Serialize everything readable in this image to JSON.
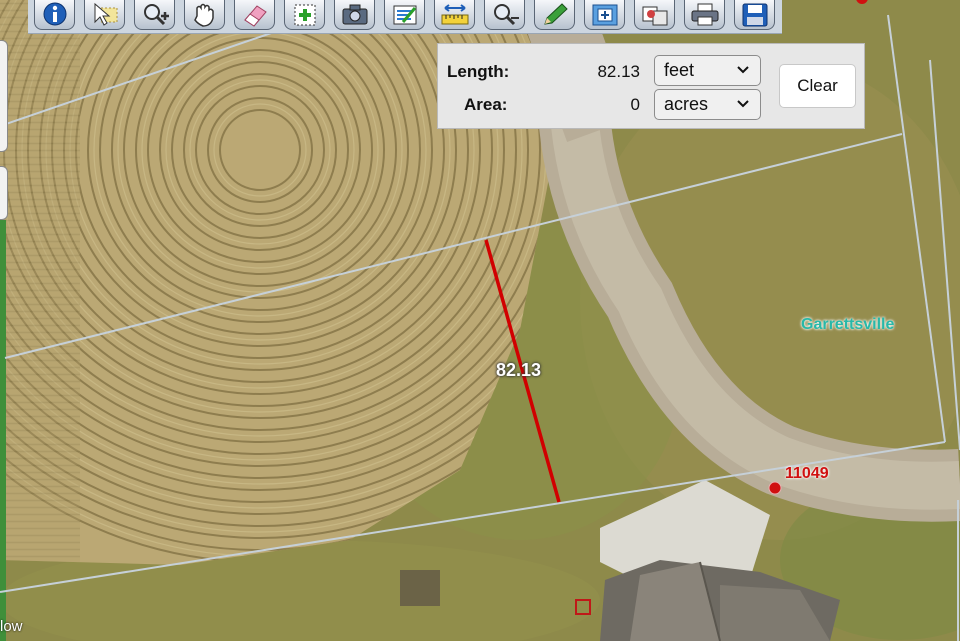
{
  "toolbar": {
    "tools": [
      {
        "name": "info-icon"
      },
      {
        "name": "select-pointer-icon"
      },
      {
        "name": "zoom-in-icon"
      },
      {
        "name": "pan-hand-icon"
      },
      {
        "name": "eraser-icon"
      },
      {
        "name": "add-selection-icon"
      },
      {
        "name": "camera-icon"
      },
      {
        "name": "layers-icon"
      },
      {
        "name": "measure-ruler-icon"
      },
      {
        "name": "zoom-out-icon"
      },
      {
        "name": "pencil-icon"
      },
      {
        "name": "select-box-icon"
      },
      {
        "name": "identify-icon"
      },
      {
        "name": "print-icon"
      },
      {
        "name": "save-icon"
      }
    ]
  },
  "measure": {
    "length_label": "Length:",
    "length_value": "82.13",
    "length_unit": "feet",
    "area_label": "Area:",
    "area_value": "0",
    "area_unit": "acres",
    "clear_label": "Clear"
  },
  "map": {
    "measure_line_label": "82.13",
    "place_label": "Garrettsville",
    "parcel_label": "11049",
    "corner_text": "low",
    "colors": {
      "measure_line": "#d10000",
      "parcel_line": "#c6d0d8",
      "place_label": "#28b8a8",
      "parcel_label": "#d01010"
    }
  }
}
